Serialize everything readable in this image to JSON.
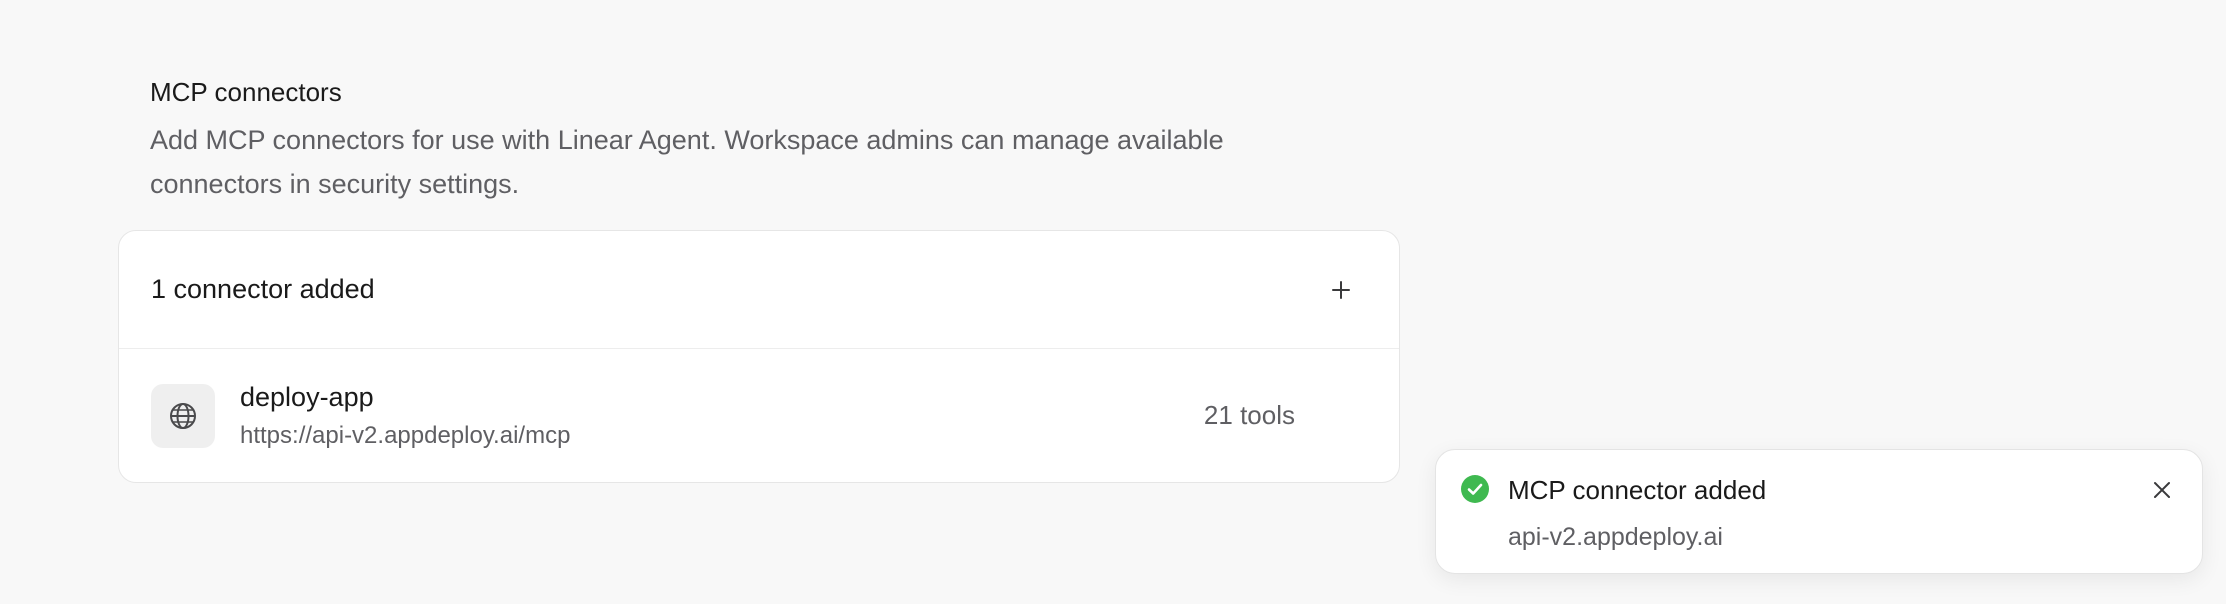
{
  "section": {
    "title": "MCP connectors",
    "description": "Add MCP connectors for use with Linear Agent. Workspace admins can manage available connectors in security settings."
  },
  "card": {
    "header_title": "1 connector added",
    "add_icon": "plus-icon",
    "connectors": [
      {
        "name": "deploy-app",
        "url": "https://api-v2.appdeploy.ai/mcp",
        "tools": "21 tools",
        "icon": "globe-icon"
      }
    ]
  },
  "toast": {
    "title": "MCP connector added",
    "subtitle": "api-v2.appdeploy.ai",
    "status_icon": "check-circle-icon",
    "close_icon": "close-icon"
  },
  "colors": {
    "background": "#f8f8f8",
    "card": "#ffffff",
    "success": "#3fb950",
    "text_primary": "#1a1a1a",
    "text_secondary": "#5f5f63"
  }
}
